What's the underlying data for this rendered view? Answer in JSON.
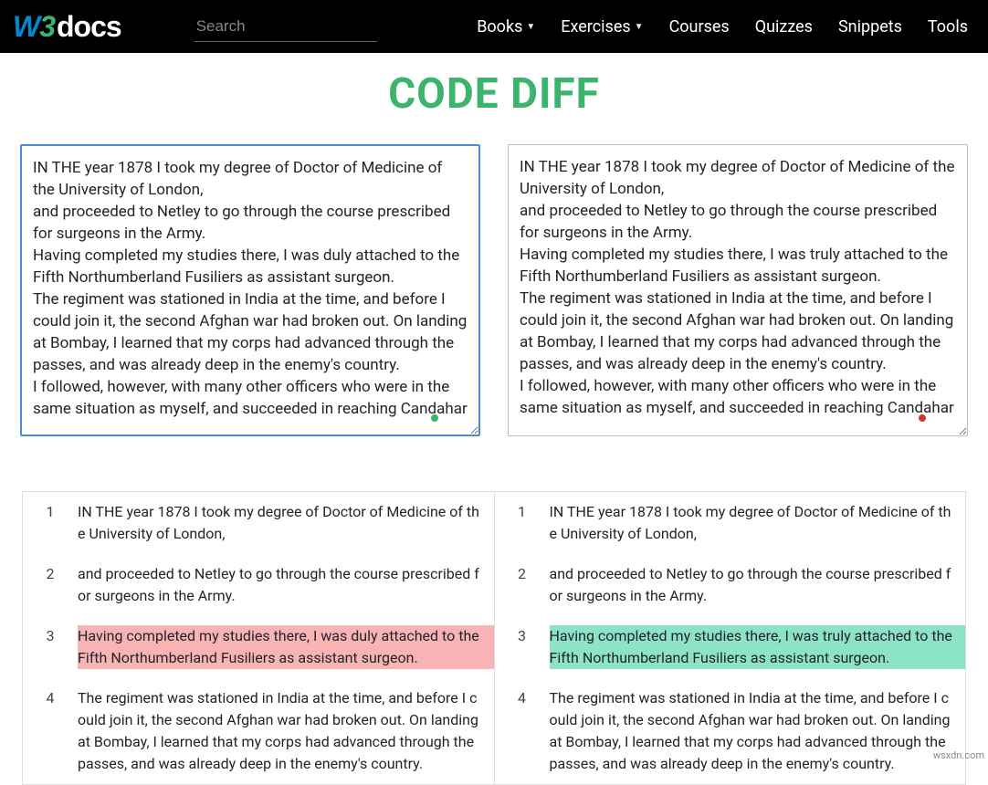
{
  "nav": {
    "search_placeholder": "Search",
    "items": [
      "Books",
      "Exercises",
      "Courses",
      "Quizzes",
      "Snippets",
      "Tools"
    ],
    "dropdown_flags": [
      true,
      true,
      false,
      false,
      false,
      false
    ]
  },
  "title": "CODE DIFF",
  "left_text": "IN THE year 1878 I took my degree of Doctor of Medicine of the University of London,\nand proceeded to Netley to go through the course prescribed for surgeons in the Army.\nHaving completed my studies there, I was duly attached to the Fifth Northumberland Fusiliers as assistant surgeon.\nThe regiment was stationed in India at the time, and before I could join it, the second Afghan war had broken out. On landing at Bombay, I learned that my corps had advanced through the passes, and was already deep in the enemy's country.\nI followed, however, with many other officers who were in the same situation as myself, and succeeded in reaching Candahar",
  "right_text": "IN THE year 1878 I took my degree of Doctor of Medicine of the University of London,\nand proceeded to Netley to go through the course prescribed for surgeons in the Army.\nHaving completed my studies there, I was truly attached to the Fifth Northumberland Fusiliers as assistant surgeon.\nThe regiment was stationed in India at the time, and before I could join it, the second Afghan war had broken out. On landing at Bombay, I learned that my corps had advanced through the passes, and was already deep in the enemy's country.\nI followed, however, with many other officers who were in the same situation as myself, and succeeded in reaching Candahar",
  "diff_left": [
    {
      "n": "1",
      "t": "IN THE year 1878 I took my degree of Doctor of Medicine of the University of London,",
      "cls": ""
    },
    {
      "n": "2",
      "t": "and proceeded to Netley to go through the course prescribed for surgeons in the Army.",
      "cls": ""
    },
    {
      "n": "3",
      "t": "Having completed my studies there, I was duly attached to the Fifth Northumberland Fusiliers as assistant surgeon.",
      "cls": "removed"
    },
    {
      "n": "4",
      "t": "The regiment was stationed in India at the time, and before I could join it, the second Afghan war had broken out. On landing at Bombay, I learned that my corps had advanced through the passes, and was already deep in the enemy's country.",
      "cls": ""
    }
  ],
  "diff_right": [
    {
      "n": "1",
      "t": "IN THE year 1878 I took my degree of Doctor of Medicine of the University of London,",
      "cls": ""
    },
    {
      "n": "2",
      "t": "and proceeded to Netley to go through the course prescribed for surgeons in the Army.",
      "cls": ""
    },
    {
      "n": "3",
      "t": "Having completed my studies there, I was truly attached to the Fifth Northumberland Fusiliers as assistant surgeon.",
      "cls": "added"
    },
    {
      "n": "4",
      "t": "The regiment was stationed in India at the time, and before I could join it, the second Afghan war had broken out. On landing at Bombay, I learned that my corps had advanced through the passes, and was already deep in the enemy's country.",
      "cls": ""
    }
  ],
  "watermark": "wsxdn.com"
}
